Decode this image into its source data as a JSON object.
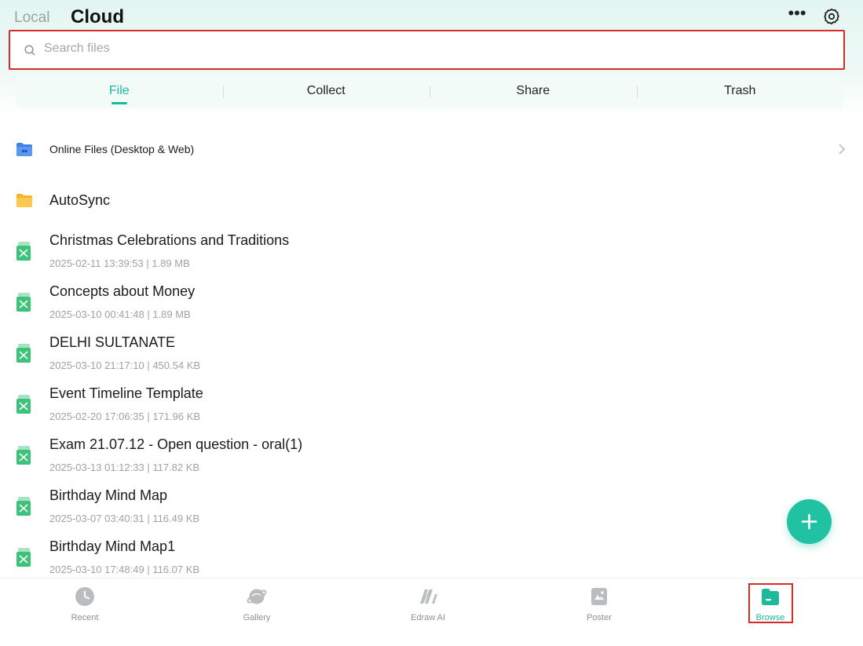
{
  "header": {
    "tab_local": "Local",
    "tab_cloud": "Cloud",
    "more_icon": "more-horizontal-icon",
    "settings_icon": "gear-icon"
  },
  "search": {
    "placeholder": "Search files",
    "value": ""
  },
  "segments": [
    {
      "label": "File",
      "active": true
    },
    {
      "label": "Collect",
      "active": false
    },
    {
      "label": "Share",
      "active": false
    },
    {
      "label": "Trash",
      "active": false
    }
  ],
  "folders": [
    {
      "name": "Online Files (Desktop & Web)",
      "icon": "cloud-folder-icon",
      "has_chevron": true
    },
    {
      "name": "AutoSync",
      "icon": "folder-icon",
      "has_chevron": false
    }
  ],
  "files": [
    {
      "name": "Christmas Celebrations and Traditions",
      "meta": "2025-02-11 13:39:53 | 1.89 MB"
    },
    {
      "name": "Concepts about Money",
      "meta": "2025-03-10 00:41:48 | 1.89 MB"
    },
    {
      "name": "DELHI SULTANATE",
      "meta": "2025-03-10 21:17:10 | 450.54 KB"
    },
    {
      "name": "Event Timeline Template",
      "meta": "2025-02-20 17:06:35 | 171.96 KB"
    },
    {
      "name": "Exam 21.07.12 - Open question - oral(1)",
      "meta": "2025-03-13 01:12:33 | 117.82 KB"
    },
    {
      "name": "Birthday Mind Map",
      "meta": "2025-03-07 03:40:31 | 116.49 KB"
    },
    {
      "name": "Birthday Mind Map1",
      "meta": "2025-03-10 17:48:49 | 116.07 KB"
    }
  ],
  "fab": {
    "icon": "plus-icon"
  },
  "bottom_nav": [
    {
      "label": "Recent",
      "icon": "clock-icon",
      "active": false
    },
    {
      "label": "Gallery",
      "icon": "planet-icon",
      "active": false
    },
    {
      "label": "Edraw AI",
      "icon": "edraw-ai-icon",
      "active": false
    },
    {
      "label": "Poster",
      "icon": "poster-icon",
      "active": false
    },
    {
      "label": "Browse",
      "icon": "browse-folder-icon",
      "active": true
    }
  ],
  "colors": {
    "accent": "#1fb89b",
    "highlight_border": "#d92a2a",
    "mindmap_file": "#3dc279"
  }
}
